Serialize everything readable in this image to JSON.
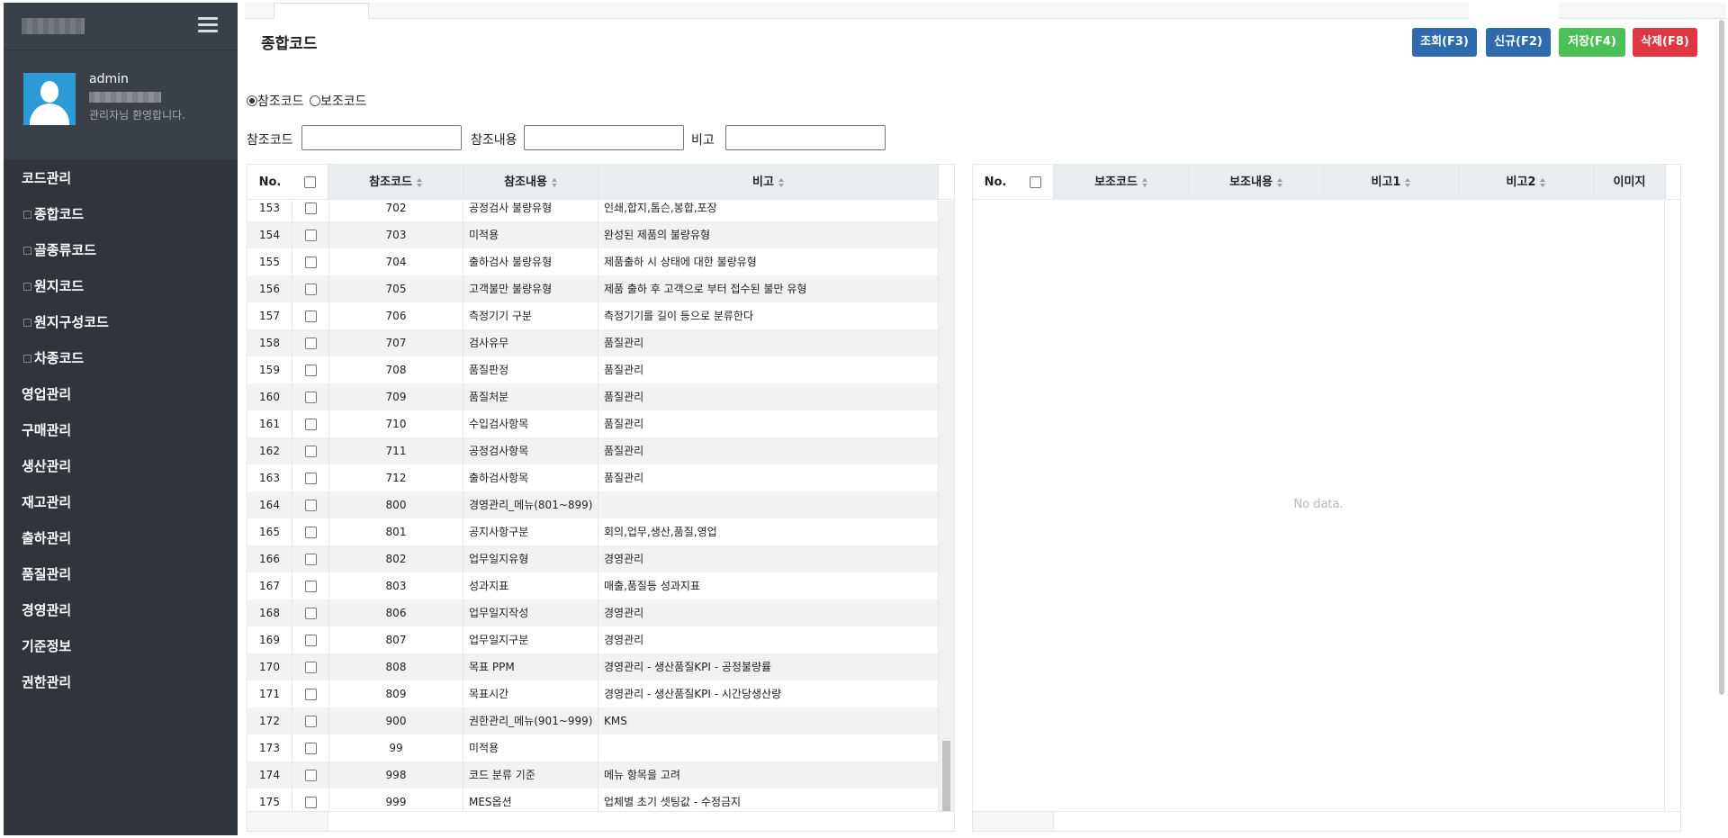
{
  "sidebar": {
    "user": {
      "name": "admin",
      "welcome": "관리자님 환영합니다."
    },
    "menu": [
      {
        "label": "코드관리",
        "sub": false
      },
      {
        "label": "종합코드",
        "sub": true
      },
      {
        "label": "골종류코드",
        "sub": true
      },
      {
        "label": "원지코드",
        "sub": true
      },
      {
        "label": "원지구성코드",
        "sub": true
      },
      {
        "label": "차종코드",
        "sub": true
      },
      {
        "label": "영업관리",
        "sub": false
      },
      {
        "label": "구매관리",
        "sub": false
      },
      {
        "label": "생산관리",
        "sub": false
      },
      {
        "label": "재고관리",
        "sub": false
      },
      {
        "label": "출하관리",
        "sub": false
      },
      {
        "label": "품질관리",
        "sub": false
      },
      {
        "label": "경영관리",
        "sub": false
      },
      {
        "label": "기준정보",
        "sub": false
      },
      {
        "label": "권한관리",
        "sub": false
      }
    ]
  },
  "page": {
    "title": "종합코드"
  },
  "toolbar": {
    "search_label": "조회(F3)",
    "new_label": "신규(F2)",
    "save_label": "저장(F4)",
    "delete_label": "삭제(F8)"
  },
  "radios": {
    "ref_label": "참조코드",
    "sub_label": "보조코드"
  },
  "filters": {
    "ref_code_label": "참조코드",
    "ref_content_label": "참조내용",
    "note_label": "비고",
    "ref_code_value": "",
    "ref_content_value": "",
    "note_value": ""
  },
  "left_grid": {
    "headers": [
      "No.",
      "참조코드",
      "참조내용",
      "비고"
    ],
    "rows": [
      [
        "153",
        "702",
        "공정검사 불량유형",
        "인쇄,합지,톰슨,봉합,포장"
      ],
      [
        "154",
        "703",
        "미적용",
        "완성된 제품의 불량유형"
      ],
      [
        "155",
        "704",
        "출하검사 불량유형",
        "제품출하 시 상태에 대한 불량유형"
      ],
      [
        "156",
        "705",
        "고객불만 불량유형",
        "제품 출하 후 고객으로 부터 접수된 불만 유형"
      ],
      [
        "157",
        "706",
        "측정기기 구분",
        "측정기기를 길이 등으로 분류한다"
      ],
      [
        "158",
        "707",
        "검사유무",
        "품질관리"
      ],
      [
        "159",
        "708",
        "품질판정",
        "품질관리"
      ],
      [
        "160",
        "709",
        "품질처분",
        "품질관리"
      ],
      [
        "161",
        "710",
        "수입검사항목",
        "품질관리"
      ],
      [
        "162",
        "711",
        "공정검사항목",
        "품질관리"
      ],
      [
        "163",
        "712",
        "출하검사항목",
        "품질관리"
      ],
      [
        "164",
        "800",
        "경영관리_메뉴(801~899)",
        ""
      ],
      [
        "165",
        "801",
        "공지사항구분",
        "회의,업무,생산,품질,영업"
      ],
      [
        "166",
        "802",
        "업무일지유형",
        "경영관리"
      ],
      [
        "167",
        "803",
        "성과지표",
        "매출,품질등 성과지표"
      ],
      [
        "168",
        "806",
        "업무일지작성",
        "경영관리"
      ],
      [
        "169",
        "807",
        "업무일지구분",
        "경영관리"
      ],
      [
        "170",
        "808",
        "목표 PPM",
        "경영관리 - 생산품질KPI - 공정불량률"
      ],
      [
        "171",
        "809",
        "목표시간",
        "경영관리 - 생산품질KPI - 시간당생산량"
      ],
      [
        "172",
        "900",
        "권한관리_메뉴(901~999)",
        "KMS"
      ],
      [
        "173",
        "99",
        "미적용",
        ""
      ],
      [
        "174",
        "998",
        "코드 분류 기준",
        "메뉴 항목을 고려"
      ],
      [
        "175",
        "999",
        "MES옵션",
        "업체별 초기 셋팅값 - 수정금지"
      ]
    ]
  },
  "right_grid": {
    "headers": [
      "No.",
      "보조코드",
      "보조내용",
      "비고1",
      "비고2",
      "이미지"
    ],
    "empty_text": "No data."
  }
}
